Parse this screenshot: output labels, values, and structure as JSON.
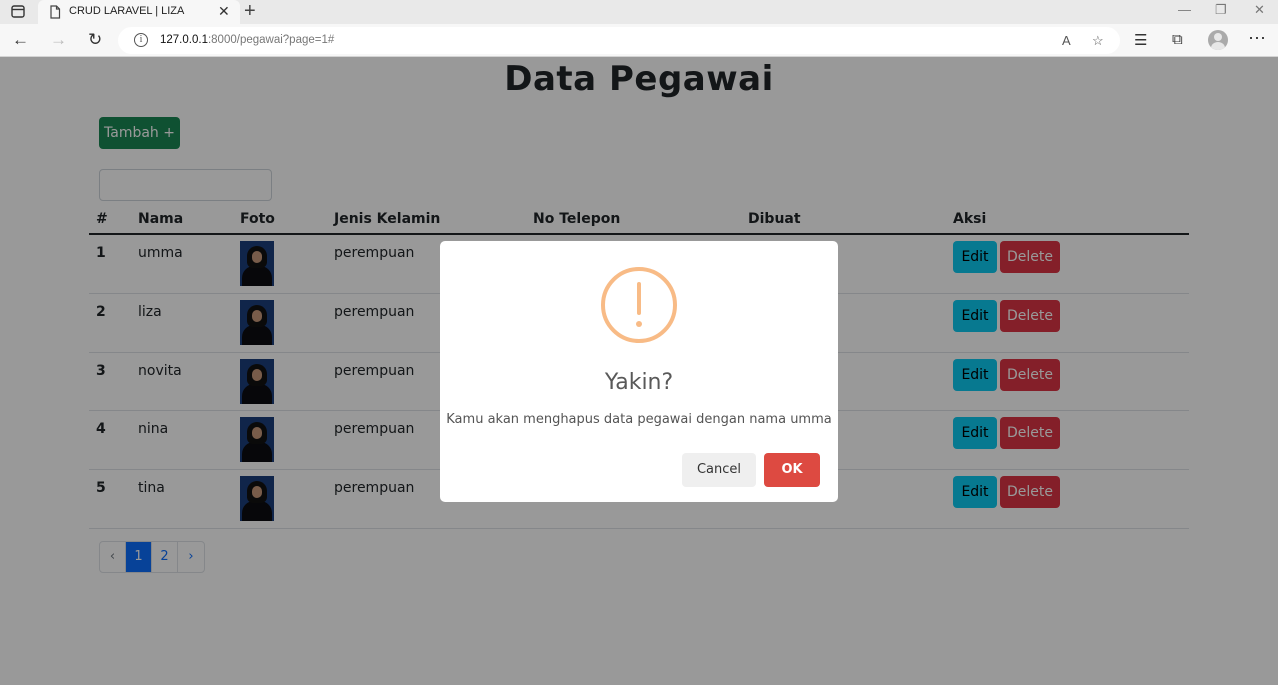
{
  "browser": {
    "tab_title": "CRUD LARAVEL | LIZA",
    "url_host": "127.0.0.1",
    "url_rest": ":8000/pegawai?page=1#"
  },
  "page": {
    "title": "Data Pegawai",
    "add_button": "Tambah +",
    "search_value": "",
    "table": {
      "headers": [
        "#",
        "Nama",
        "Foto",
        "Jenis Kelamin",
        "No Telepon",
        "Dibuat",
        "Aksi"
      ],
      "rows": [
        {
          "num": "1",
          "nama": "umma",
          "jenis_kelamin": "perempuan",
          "no_telepon": "",
          "dibuat": ""
        },
        {
          "num": "2",
          "nama": "liza",
          "jenis_kelamin": "perempuan",
          "no_telepon": "",
          "dibuat": ""
        },
        {
          "num": "3",
          "nama": "novita",
          "jenis_kelamin": "perempuan",
          "no_telepon": "",
          "dibuat": ""
        },
        {
          "num": "4",
          "nama": "nina",
          "jenis_kelamin": "perempuan",
          "no_telepon": "",
          "dibuat": ""
        },
        {
          "num": "5",
          "nama": "tina",
          "jenis_kelamin": "perempuan",
          "no_telepon": "",
          "dibuat": ""
        }
      ],
      "edit_label": "Edit",
      "delete_label": "Delete"
    },
    "pagination": {
      "prev": "‹",
      "pages": [
        "1",
        "2"
      ],
      "active": "1",
      "next": "›"
    }
  },
  "modal": {
    "title": "Yakin?",
    "text": "Kamu akan menghapus data pegawai dengan nama umma",
    "cancel_label": "Cancel",
    "ok_label": "OK"
  },
  "colors": {
    "add_button": "#198754",
    "edit_button": "#0dcaf0",
    "delete_button": "#dc3545",
    "ok_button": "#dd4a41",
    "warning_icon": "#f8bb86"
  }
}
